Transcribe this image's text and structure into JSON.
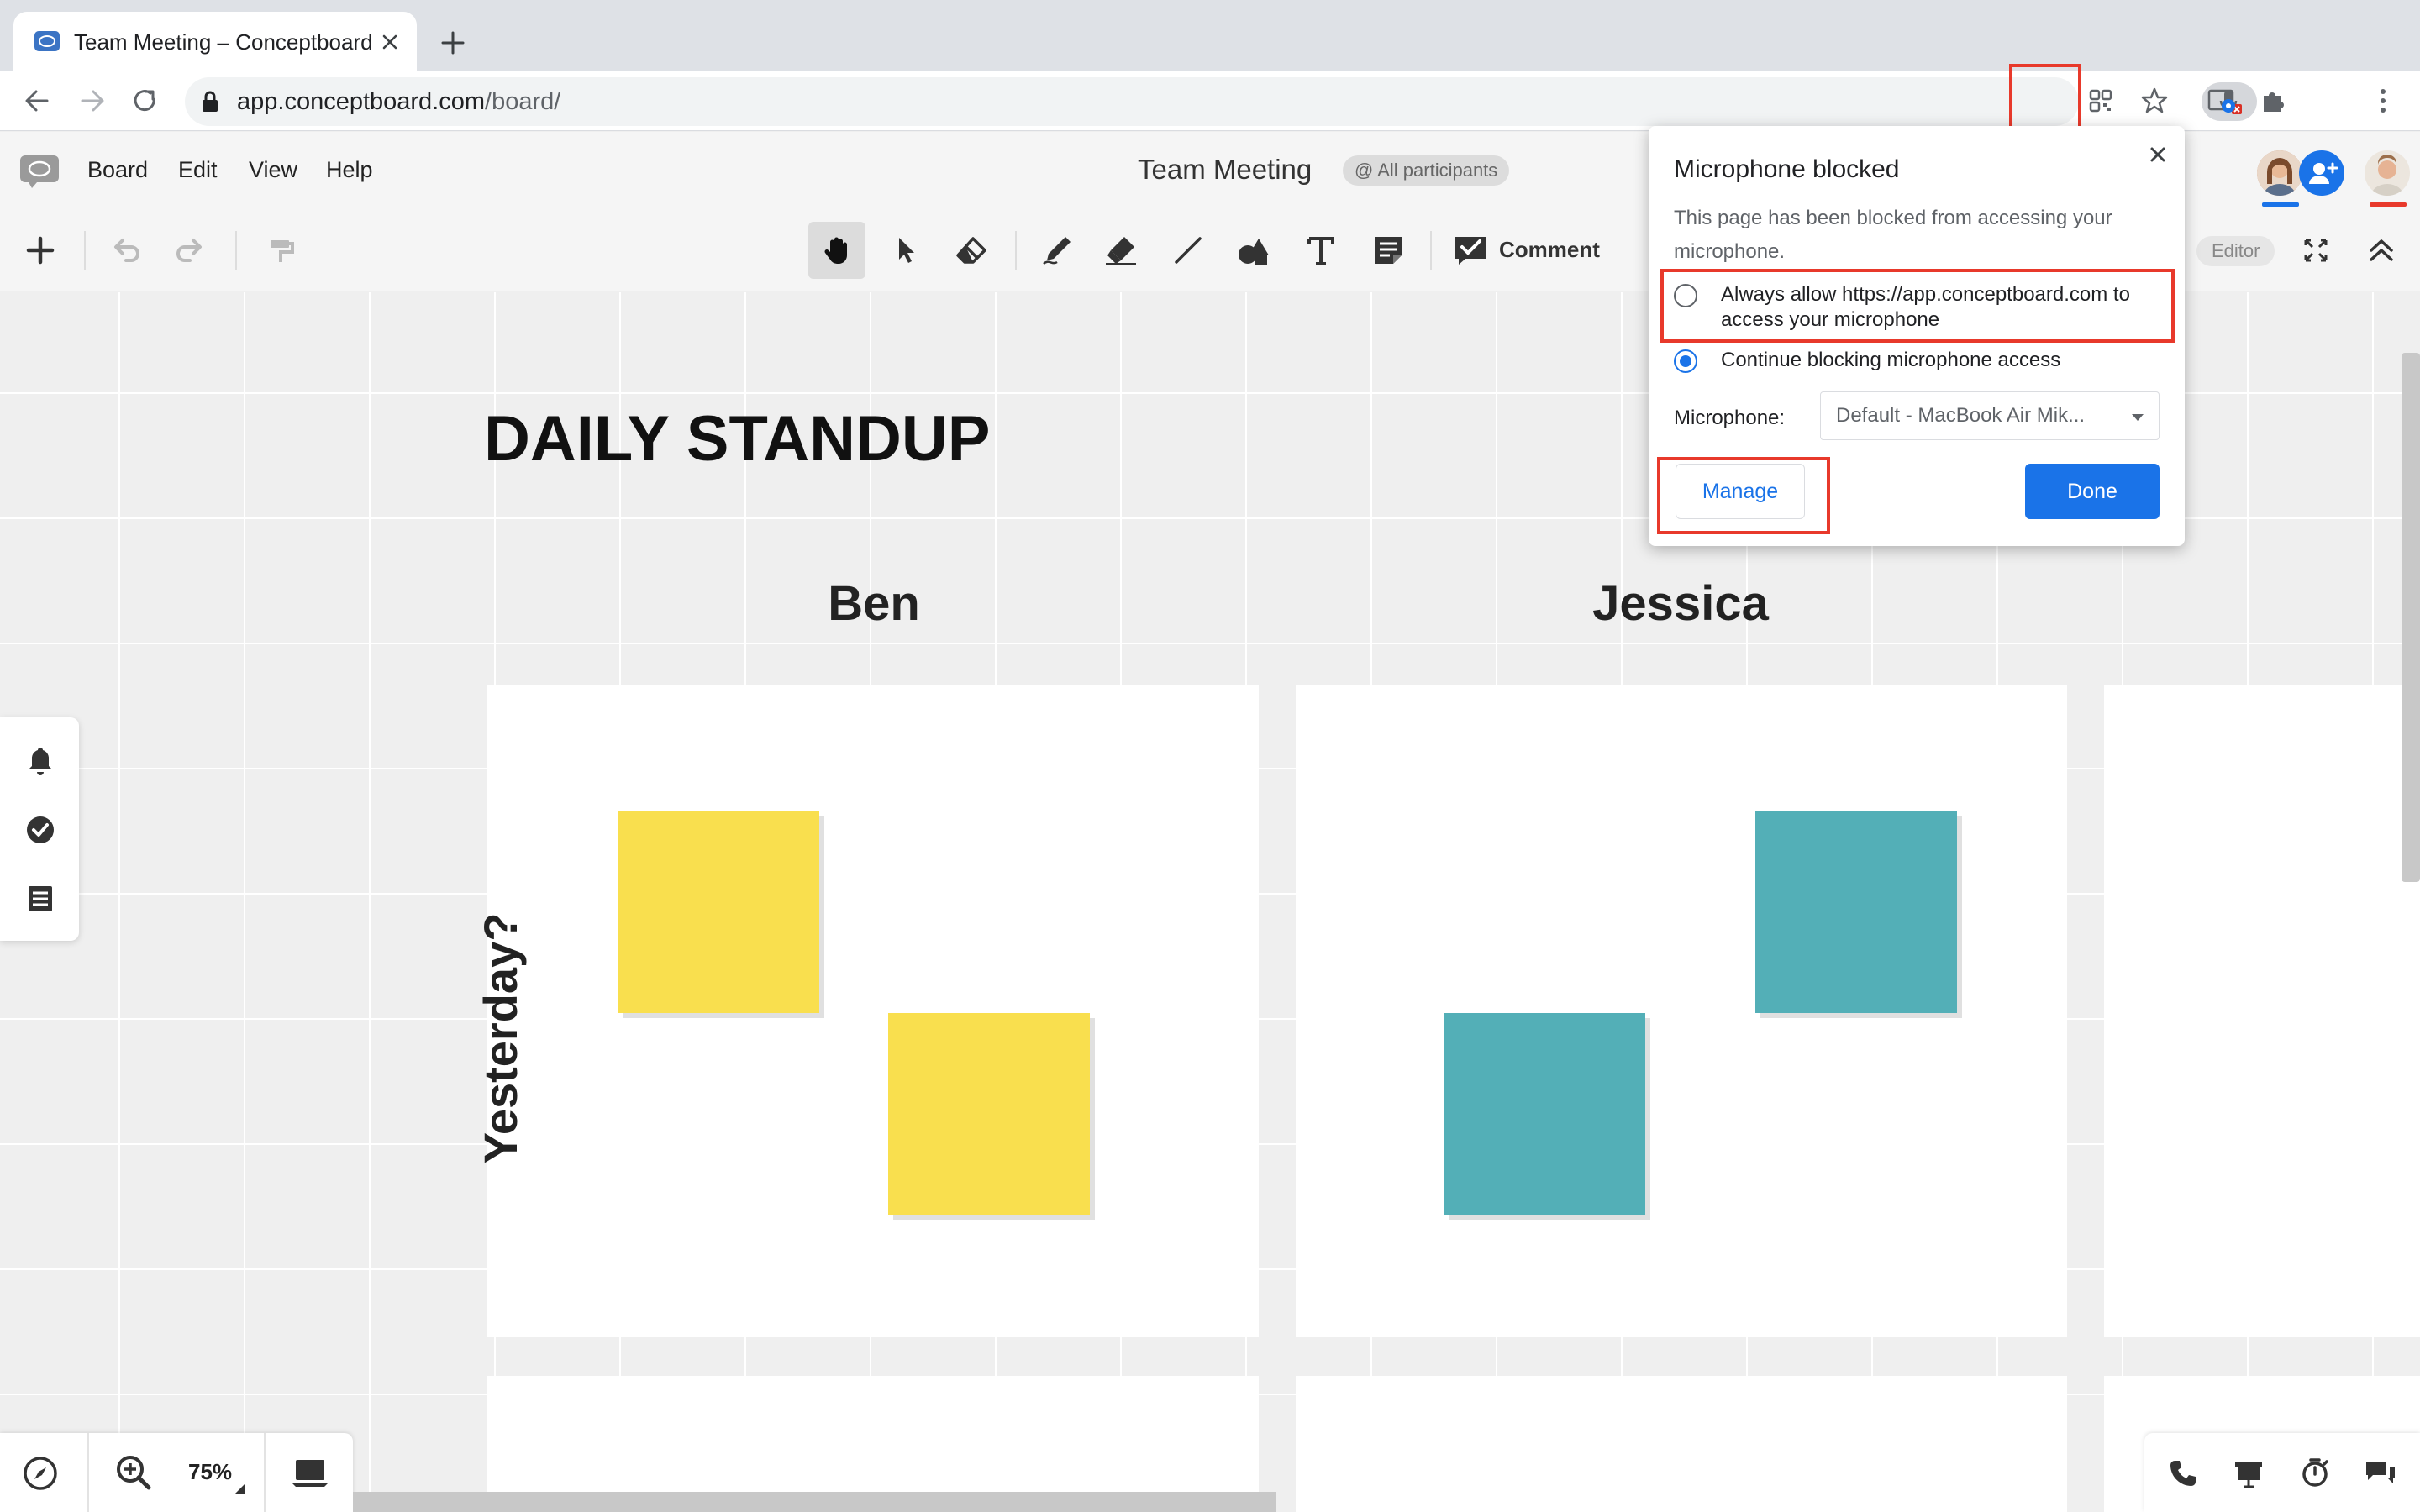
{
  "browser": {
    "tab_title": "Team Meeting – Conceptboard",
    "url_host": "app.conceptboard.com",
    "url_path": "/board/"
  },
  "app": {
    "menu": [
      "Board",
      "Edit",
      "View",
      "Help"
    ],
    "board_title": "Team Meeting",
    "participants_label": "@ All participants",
    "comment_label": "Comment",
    "editor_label": "Editor",
    "zoom": "75%"
  },
  "board": {
    "heading": "DAILY STANDUP",
    "columns": [
      "Ben",
      "Jessica"
    ],
    "row_label": "Yesterday?",
    "sticky_colors": {
      "yellow": "#f9df4e",
      "teal": "#53afb7"
    }
  },
  "popup": {
    "title": "Microphone blocked",
    "message": "This page has been blocked from accessing your microphone.",
    "option_allow": "Always allow https://app.conceptboard.com to access your microphone",
    "option_block": "Continue blocking microphone access",
    "selected_option": "block",
    "mic_label": "Microphone:",
    "mic_value": "Default - MacBook Air Mik...",
    "manage_label": "Manage",
    "done_label": "Done"
  },
  "colors": {
    "accent": "#1a73e8",
    "highlight": "#e8392b"
  }
}
